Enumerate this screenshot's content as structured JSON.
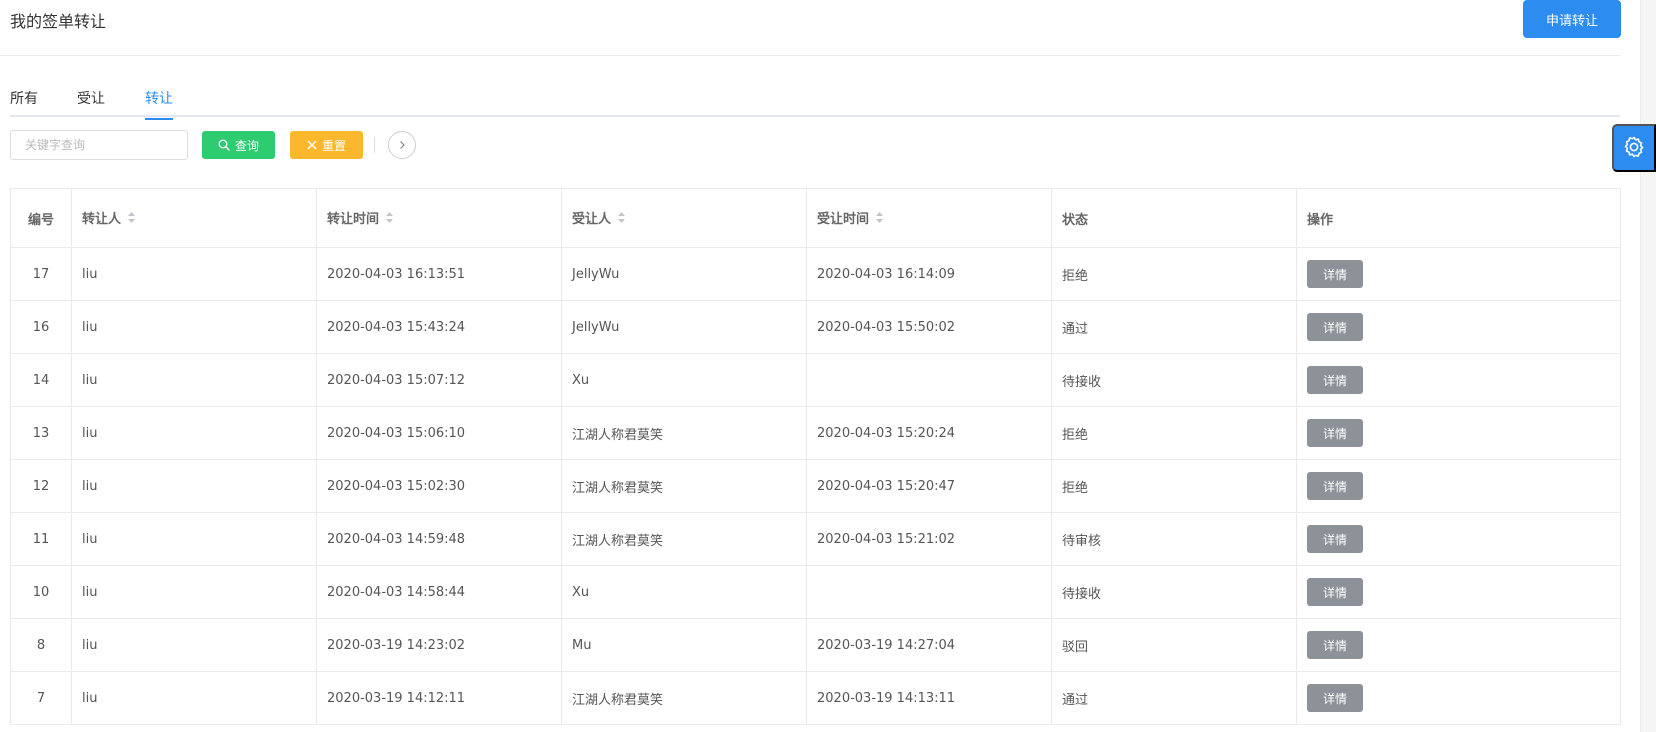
{
  "header": {
    "title": "我的签单转让",
    "apply_button": "申请转让"
  },
  "tabs": [
    {
      "label": "所有",
      "active": false
    },
    {
      "label": "受让",
      "active": false
    },
    {
      "label": "转让",
      "active": true
    }
  ],
  "toolbar": {
    "search_placeholder": "关键字查询",
    "query_label": "查询",
    "reset_label": "重置",
    "query_color": "#2ecc71",
    "reset_color": "#fbb82c"
  },
  "accent_color": "#2d8cf0",
  "table": {
    "columns": [
      "编号",
      "转让人",
      "转让时间",
      "受让人",
      "受让时间",
      "状态",
      "操作"
    ],
    "detail_label": "详情",
    "rows": [
      {
        "id": "17",
        "transferor": "liu",
        "transfer_time": "2020-04-03 16:13:51",
        "transferee": "JellyWu",
        "accept_time": "2020-04-03 16:14:09",
        "status": "拒绝"
      },
      {
        "id": "16",
        "transferor": "liu",
        "transfer_time": "2020-04-03 15:43:24",
        "transferee": "JellyWu",
        "accept_time": "2020-04-03 15:50:02",
        "status": "通过"
      },
      {
        "id": "14",
        "transferor": "liu",
        "transfer_time": "2020-04-03 15:07:12",
        "transferee": "Xu",
        "accept_time": "",
        "status": "待接收"
      },
      {
        "id": "13",
        "transferor": "liu",
        "transfer_time": "2020-04-03 15:06:10",
        "transferee": "江湖人称君莫笑",
        "accept_time": "2020-04-03 15:20:24",
        "status": "拒绝"
      },
      {
        "id": "12",
        "transferor": "liu",
        "transfer_time": "2020-04-03 15:02:30",
        "transferee": "江湖人称君莫笑",
        "accept_time": "2020-04-03 15:20:47",
        "status": "拒绝"
      },
      {
        "id": "11",
        "transferor": "liu",
        "transfer_time": "2020-04-03 14:59:48",
        "transferee": "江湖人称君莫笑",
        "accept_time": "2020-04-03 15:21:02",
        "status": "待审核"
      },
      {
        "id": "10",
        "transferor": "liu",
        "transfer_time": "2020-04-03 14:58:44",
        "transferee": "Xu",
        "accept_time": "",
        "status": "待接收"
      },
      {
        "id": "8",
        "transferor": "liu",
        "transfer_time": "2020-03-19 14:23:02",
        "transferee": "Mu",
        "accept_time": "2020-03-19 14:27:04",
        "status": "驳回"
      },
      {
        "id": "7",
        "transferor": "liu",
        "transfer_time": "2020-03-19 14:12:11",
        "transferee": "江湖人称君莫笑",
        "accept_time": "2020-03-19 14:13:11",
        "status": "通过"
      }
    ]
  }
}
